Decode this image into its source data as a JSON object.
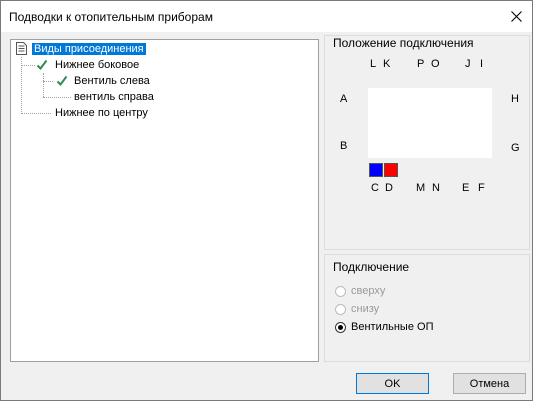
{
  "window": {
    "title": "Подводки к отопительным приборам"
  },
  "tree": {
    "root": "Виды присоединения",
    "items": [
      {
        "label": "Нижнее боковое",
        "checked": true
      },
      {
        "label": "Вентиль слева",
        "checked": true
      },
      {
        "label": "вентиль справа",
        "checked": false
      },
      {
        "label": "Нижнее по центру",
        "checked": false
      }
    ]
  },
  "position_group": {
    "title": "Положение подключения",
    "letters": {
      "L": "L",
      "K": "K",
      "P": "P",
      "O": "O",
      "J": "J",
      "I": "I",
      "A": "A",
      "H": "H",
      "B": "B",
      "G": "G",
      "C": "C",
      "D": "D",
      "M": "M",
      "N": "N",
      "E": "E",
      "F": "F"
    },
    "swatch_colors": {
      "left": "#0000ff",
      "right": "#ff0000"
    }
  },
  "connection_group": {
    "title": "Подключение",
    "options": [
      {
        "label": "сверху",
        "enabled": false,
        "selected": false
      },
      {
        "label": "снизу",
        "enabled": false,
        "selected": false
      },
      {
        "label": "Вентильные ОП",
        "enabled": true,
        "selected": true
      }
    ]
  },
  "buttons": {
    "ok": "OK",
    "cancel": "Отмена"
  },
  "colors": {
    "selection": "#0078d7",
    "check": "#2e8b57"
  }
}
